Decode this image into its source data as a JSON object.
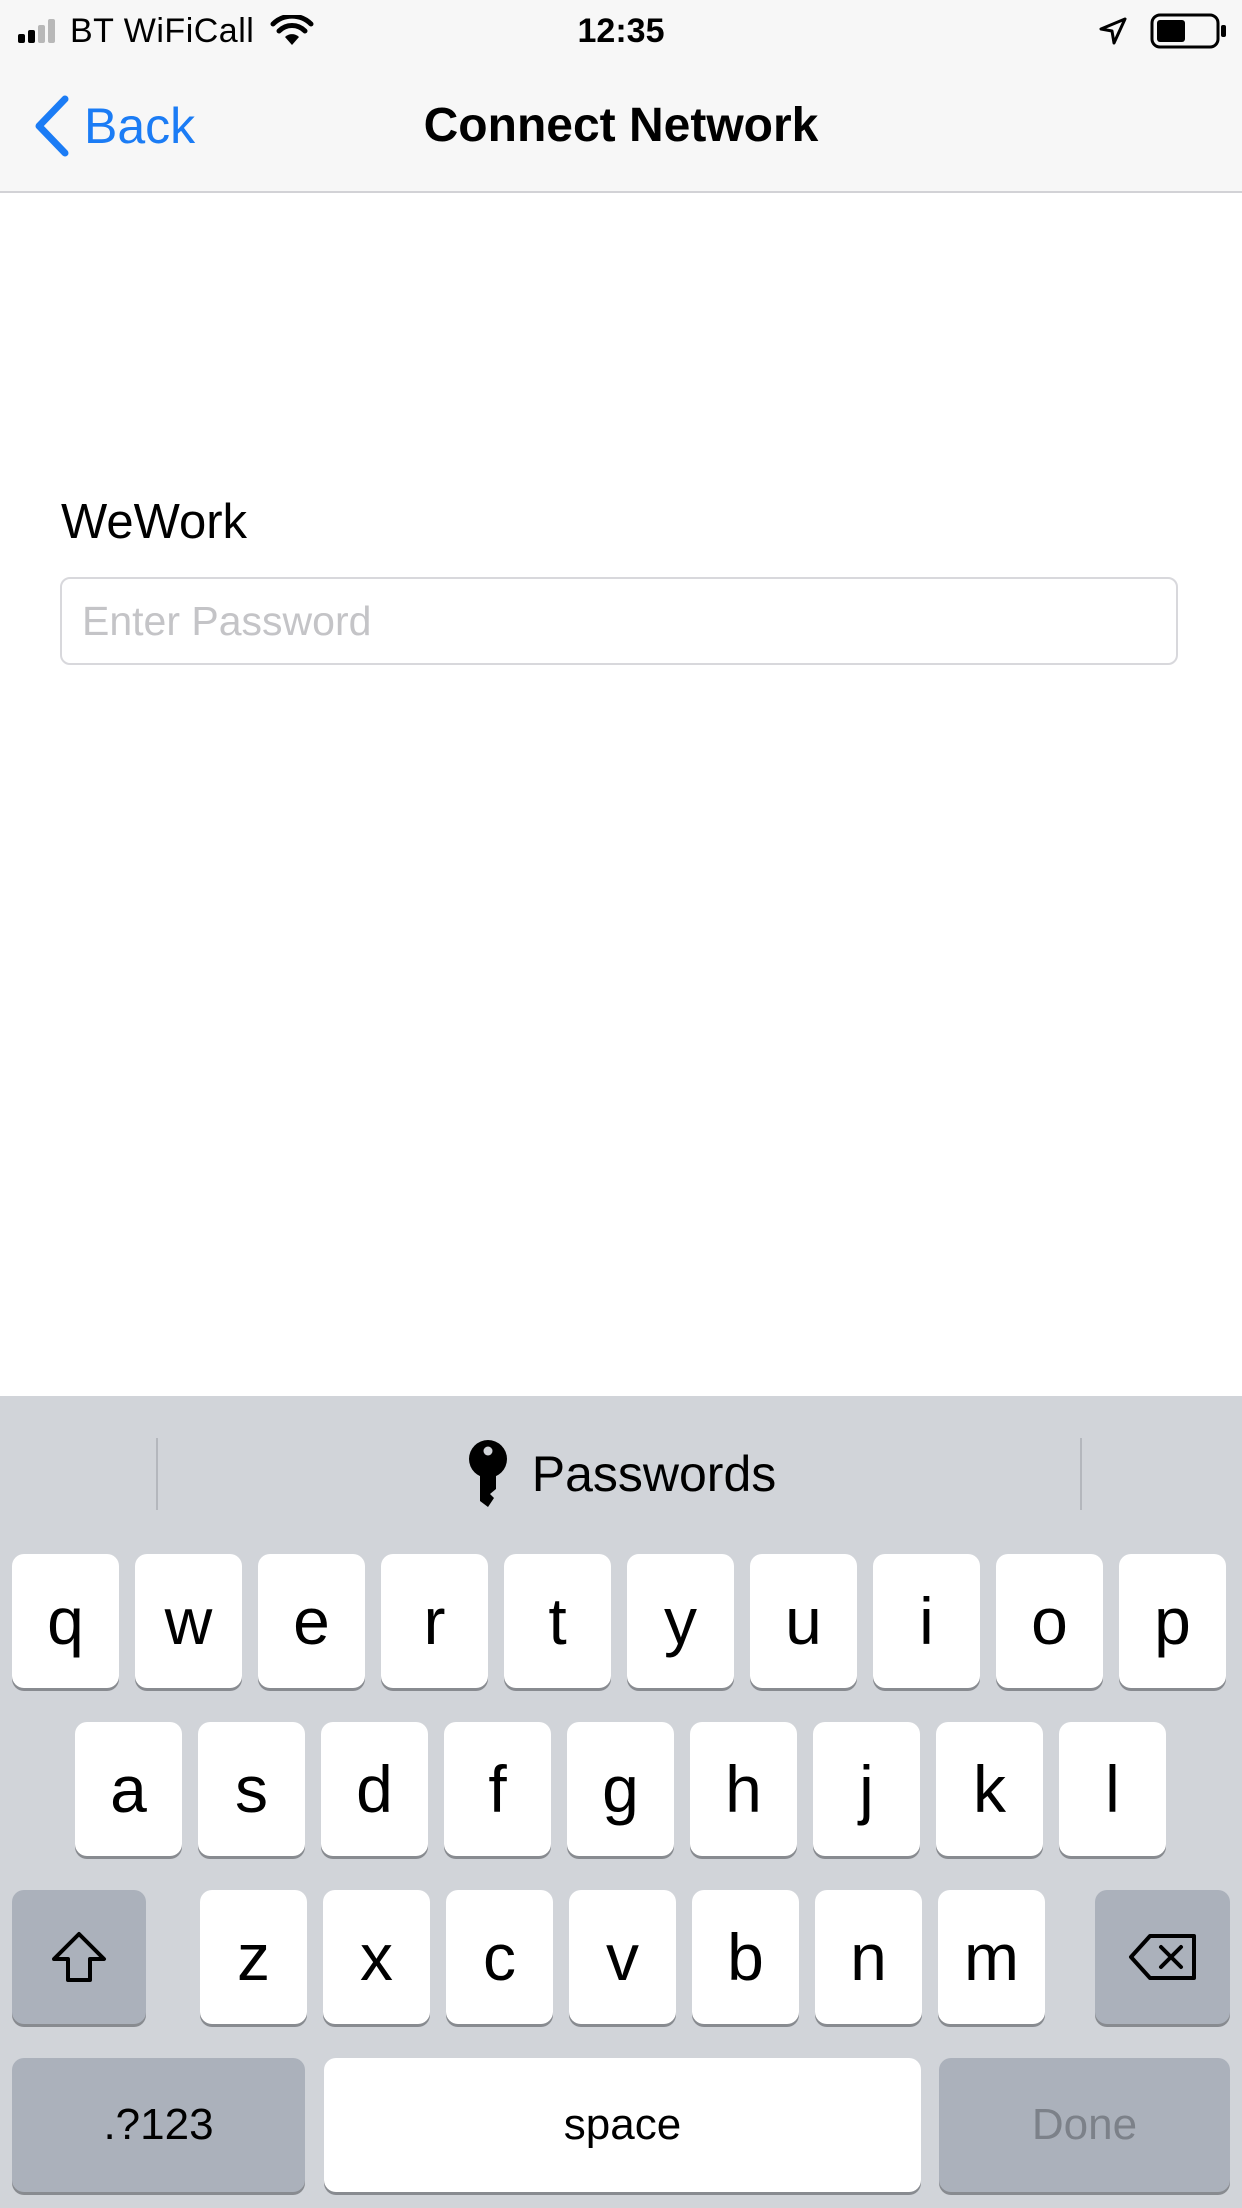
{
  "status_bar": {
    "carrier": "BT WiFiCall",
    "time": "12:35",
    "battery_level": 0.5
  },
  "nav": {
    "back_label": "Back",
    "title": "Connect Network"
  },
  "form": {
    "network_name": "WeWork",
    "password_placeholder": "Enter Password",
    "password_value": ""
  },
  "keyboard": {
    "suggestion": "Passwords",
    "row1": [
      "q",
      "w",
      "e",
      "r",
      "t",
      "y",
      "u",
      "i",
      "o",
      "p"
    ],
    "row2": [
      "a",
      "s",
      "d",
      "f",
      "g",
      "h",
      "j",
      "k",
      "l"
    ],
    "row3": [
      "z",
      "x",
      "c",
      "v",
      "b",
      "n",
      "m"
    ],
    "numbers_label": ".?123",
    "space_label": "space",
    "done_label": "Done"
  },
  "colors": {
    "accent": "#1b7cf5",
    "keyboard_bg": "#d1d4d9",
    "special_key": "#abb1bb"
  }
}
